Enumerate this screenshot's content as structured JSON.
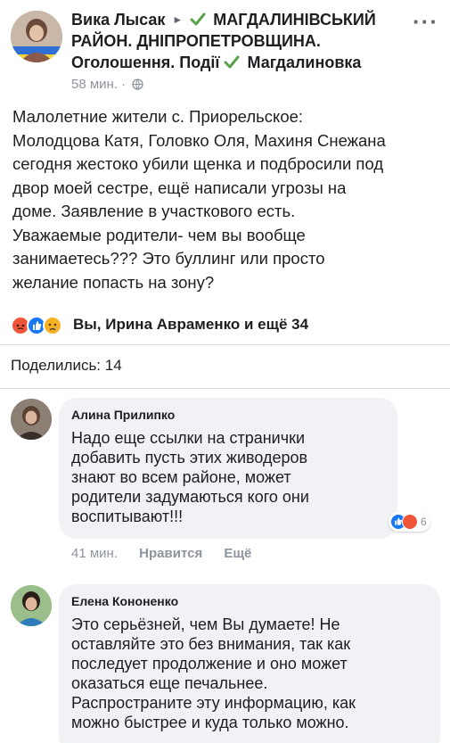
{
  "post": {
    "author": "Вика Лысак",
    "group_line1": "МАГДАЛИНІВСЬКИЙ",
    "group_line2": "РАЙОН. ДНІПРОПЕТРОВЩИНА.",
    "group_line3_a": "Оголошення. Події",
    "group_line3_b": "Магдалиновка",
    "time": "58 мин. ·",
    "text": "Малолетние жители с. Приорельское:\nМолодцова Катя, Головко Оля, Махиня Снежана\nсегодня жестоко убили щенка и подбросили под\nдвор моей сестре, ещё написали угрозы на\nдоме. Заявление в участкового есть.\nУважаемые родители- чем вы вообще\nзанимаетесь??? Это буллинг или просто\nжелание попасть на зону?",
    "reactions_summary": "Вы, Ирина Авраменко и ещё 34",
    "shares": "Поделились: 14"
  },
  "comments": [
    {
      "author": "Алина Прилипко",
      "text": "Надо еще ссылки на странички\nдобавить пусть этих живодеров\nзнают во всем районе, может\nродители задумаються кого они\nвоспитывают!!!",
      "reaction_count": "6",
      "time": "41 мин.",
      "like_label": "Нравится",
      "more_label": "Ещё"
    },
    {
      "author": "Елена Кононенко",
      "text": "Это серьёзней, чем Вы думаете! Не\nоставляйте это без внимания, так как\nпоследует продолжение и оно может\nоказаться еще печальнее.\nРаспространите эту информацию, как\nможно быстрее и куда только можно."
    }
  ],
  "icons": {
    "verified": "verified-badge-icon",
    "globe": "globe-icon",
    "more": "more-options-icon",
    "angry": "angry-reaction-icon",
    "like": "like-reaction-icon",
    "sad": "sad-reaction-icon"
  },
  "colors": {
    "verified": "#5aa24a",
    "like": "#1877f2",
    "angry": "#f0553a",
    "sad": "#f7b125"
  }
}
